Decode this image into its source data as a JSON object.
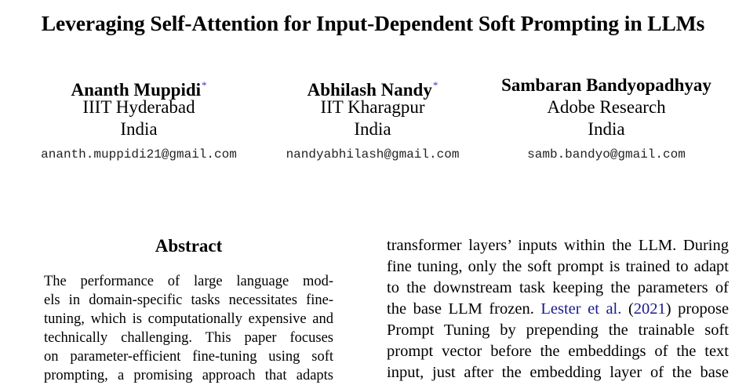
{
  "paper": {
    "title": "Leveraging Self-Attention for Input-Dependent Soft Prompting in LLMs"
  },
  "authors": [
    {
      "name": "Ananth Muppidi",
      "mark": "*",
      "affiliation": "IIIT Hyderabad",
      "country": "India",
      "email": "ananth.muppidi21@gmail.com"
    },
    {
      "name": "Abhilash Nandy",
      "mark": "*",
      "affiliation": "IIT Kharagpur",
      "country": "India",
      "email": "nandyabhilash@gmail.com"
    },
    {
      "name": "Sambaran Bandyopadhyay",
      "mark": "",
      "affiliation": "Adobe Research",
      "country": "India",
      "email": "samb.bandyo@gmail.com"
    }
  ],
  "abstract": {
    "heading": "Abstract",
    "lines": [
      "The performance of large language mod-",
      "els in domain-specific tasks necessitates fine-",
      "tuning, which is computationally expensive and",
      "technically challenging. This paper focuses",
      "on parameter-efficient fine-tuning using soft",
      "prompting, a promising approach that adapts"
    ]
  },
  "right_column": {
    "lines": [
      "transformer layers’ inputs within the LLM. During",
      "fine tuning, only the soft prompt is trained to adapt",
      "to the downstream task keeping the parameters of",
      "Prompt Tuning by prepending the trainable soft",
      "prompt vector before the embeddings of the text",
      "input, just after the embedding layer of the base"
    ],
    "citation_line": {
      "before": "the base LLM frozen.",
      "cite_author": "Lester et al.",
      "cite_open": "(",
      "cite_year": "2021",
      "cite_close": ")",
      "after": "propose"
    }
  }
}
